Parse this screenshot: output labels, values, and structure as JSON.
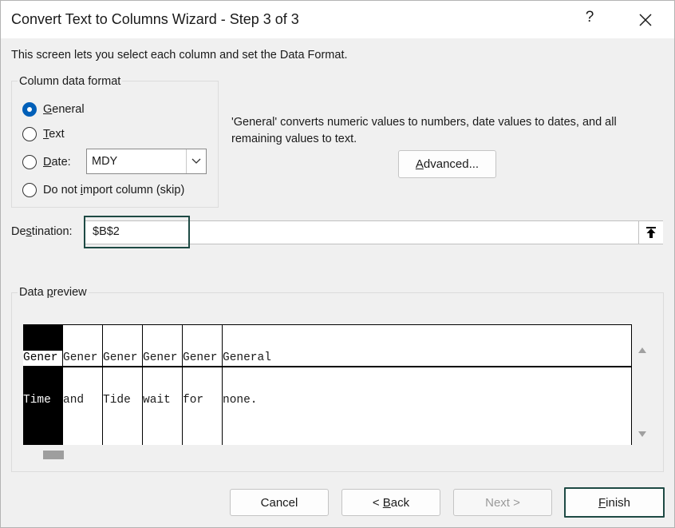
{
  "dialog": {
    "title": "Convert Text to Columns Wizard - Step 3 of 3",
    "help_label": "?",
    "intro": "This screen lets you select each column and set the Data Format."
  },
  "format_group": {
    "title": "Column data format",
    "options": [
      {
        "pre": "",
        "key": "G",
        "post": "eneral",
        "checked": true
      },
      {
        "pre": "",
        "key": "T",
        "post": "ext",
        "checked": false
      },
      {
        "pre": "",
        "key": "D",
        "post": "ate:",
        "checked": false
      },
      {
        "pre": "Do not ",
        "key": "i",
        "post": "mport column (skip)",
        "checked": false
      }
    ],
    "date_format": "MDY",
    "description": "'General' converts numeric values to numbers, date values to dates, and all remaining values to text.",
    "advanced": {
      "key": "A",
      "rest": "dvanced..."
    }
  },
  "destination": {
    "label_pre": "De",
    "label_key": "s",
    "label_post": "tination:",
    "value": "$B$2"
  },
  "preview": {
    "title_pre": "Data ",
    "title_key": "p",
    "title_post": "review",
    "columns": [
      {
        "header": "Gener",
        "cell": "Time",
        "selected": true
      },
      {
        "header": "Gener",
        "cell": "and",
        "selected": false
      },
      {
        "header": "Gener",
        "cell": "Tide",
        "selected": false
      },
      {
        "header": "Gener",
        "cell": "wait",
        "selected": false
      },
      {
        "header": "Gener",
        "cell": "for",
        "selected": false
      },
      {
        "header": "General",
        "cell": "none.",
        "selected": false
      }
    ]
  },
  "buttons": {
    "cancel": "Cancel",
    "back_pre": "< ",
    "back_key": "B",
    "back_post": "ack",
    "next": "Next >",
    "finish_key": "F",
    "finish_post": "inish"
  },
  "colors": {
    "accent": "#005fb8",
    "focus_border": "#1e4a44",
    "background": "#f0f0f0"
  }
}
